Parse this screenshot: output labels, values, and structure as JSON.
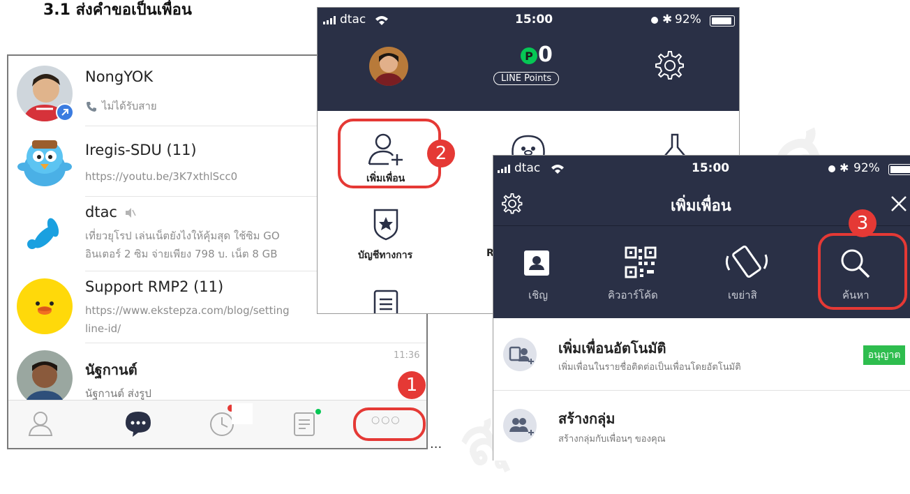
{
  "heading": "3.1 ส่งคำขอเป็นเพื่อน",
  "watermark": "สุ",
  "chat_list": {
    "chats": [
      {
        "name": "NongYOK",
        "message": "ไม่ได้รับสาย"
      },
      {
        "name": "Iregis-SDU (11)",
        "message": "https://youtu.be/3K7xthlScc0"
      },
      {
        "name": "dtac",
        "message_line1": "เที่ยวยุโรป เล่นเน็ตยังไงให้คุ้มสุด ใช้ซิม GO",
        "message_line2": "อินเตอร์ 2 ซิม จ่ายเพียง 798 บ. เน็ต 8 GB"
      },
      {
        "name": "Support RMP2 (11)",
        "message_line1": "https://www.ekstepza.com/blog/setting",
        "message_line2": "line-id/"
      },
      {
        "name": "นัฐกานต์",
        "message": "นัฐกานต์ ส่งรูป",
        "time": "11:36"
      }
    ],
    "more_button_label": "○○○",
    "ellipsis": "..."
  },
  "menu_screen": {
    "status": {
      "carrier": "dtac",
      "time": "15:00",
      "battery": "92%"
    },
    "points_value": "0",
    "points_label": "LINE Points",
    "add_friend_label": "เพิ่มเพื่อน",
    "official_accounts_label": "บัญชีทางการ",
    "cut_label": "R"
  },
  "add_friends_screen": {
    "status": {
      "carrier": "dtac",
      "time": "15:00",
      "battery": "92%"
    },
    "title": "เพิ่มเพื่อน",
    "options": [
      {
        "label": "เชิญ",
        "icon": "invite-contact-icon"
      },
      {
        "label": "คิวอาร์โค้ด",
        "icon": "qr-code-icon"
      },
      {
        "label": "เขย่าสิ",
        "icon": "shake-phone-icon"
      },
      {
        "label": "ค้นหา",
        "icon": "search-icon"
      }
    ],
    "auto_add": {
      "title": "เพิ่มเพื่อนอัตโนมัติ",
      "subtitle": "เพิ่มเพื่อนในรายชื่อติดต่อเป็นเพื่อนโดยอัตโนมัติ",
      "button": "อนุญาต"
    },
    "create_group": {
      "title": "สร้างกลุ่ม",
      "subtitle": "สร้างกลุ่มกับเพื่อนๆ ของคุณ"
    }
  },
  "step_badges": [
    "1",
    "2",
    "3"
  ],
  "colors": {
    "dark_header": "#2a3046",
    "accent_green": "#2ebd4e",
    "annotation_red": "#e53935",
    "line_green": "#06c755"
  }
}
